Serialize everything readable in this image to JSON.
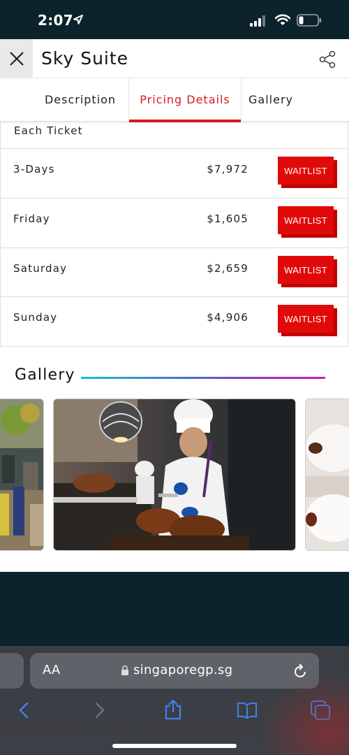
{
  "status_bar": {
    "time": "2:07"
  },
  "header": {
    "title": "Sky Suite",
    "close_icon": "close-icon",
    "share_icon": "share-icon"
  },
  "tabs": [
    {
      "label": "Description",
      "active": false
    },
    {
      "label": "Pricing Details",
      "active": true
    },
    {
      "label": "Gallery",
      "active": false
    }
  ],
  "pricing": {
    "header": "Each Ticket",
    "rows": [
      {
        "name": "3-Days",
        "price": "$7,972",
        "action": "WAITLIST"
      },
      {
        "name": "Friday",
        "price": "$1,605",
        "action": "WAITLIST"
      },
      {
        "name": "Saturday",
        "price": "$2,659",
        "action": "WAITLIST"
      },
      {
        "name": "Sunday",
        "price": "$4,906",
        "action": "WAITLIST"
      }
    ]
  },
  "gallery": {
    "heading": "Gallery"
  },
  "browser": {
    "text_size_label": "AA",
    "url": "singaporegp.sg"
  },
  "colors": {
    "accent_red": "#d9181f",
    "button_red": "#e10a0a",
    "dark_navy": "#0d232b"
  }
}
